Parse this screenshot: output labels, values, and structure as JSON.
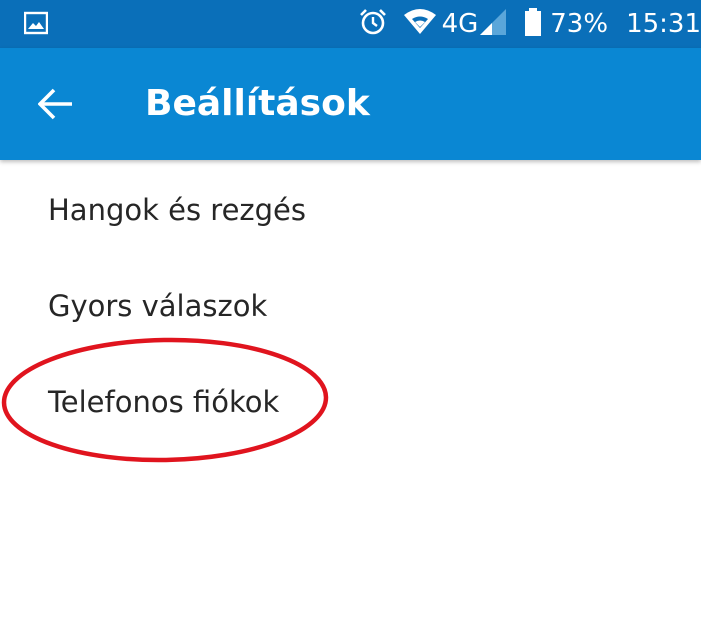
{
  "status_bar": {
    "left_icon": "image-notification-icon",
    "icons": [
      "alarm-icon",
      "wifi-icon",
      "cellular-signal-icon",
      "battery-icon"
    ],
    "network_label": "4G",
    "battery_label": "73%",
    "time": "15:31"
  },
  "app_bar": {
    "back_icon": "arrow-back-icon",
    "title": "Beállítások"
  },
  "settings": {
    "items": [
      {
        "label": "Hangok és rezgés"
      },
      {
        "label": "Gyors válaszok"
      },
      {
        "label": "Telefonos fiókok"
      }
    ]
  },
  "annotation": {
    "highlighted_item": "Telefonos fiókok",
    "color": "#e0141e"
  },
  "colors": {
    "status_bar": "#0a6fb9",
    "app_bar": "#0a87d3",
    "text": "#262626"
  }
}
